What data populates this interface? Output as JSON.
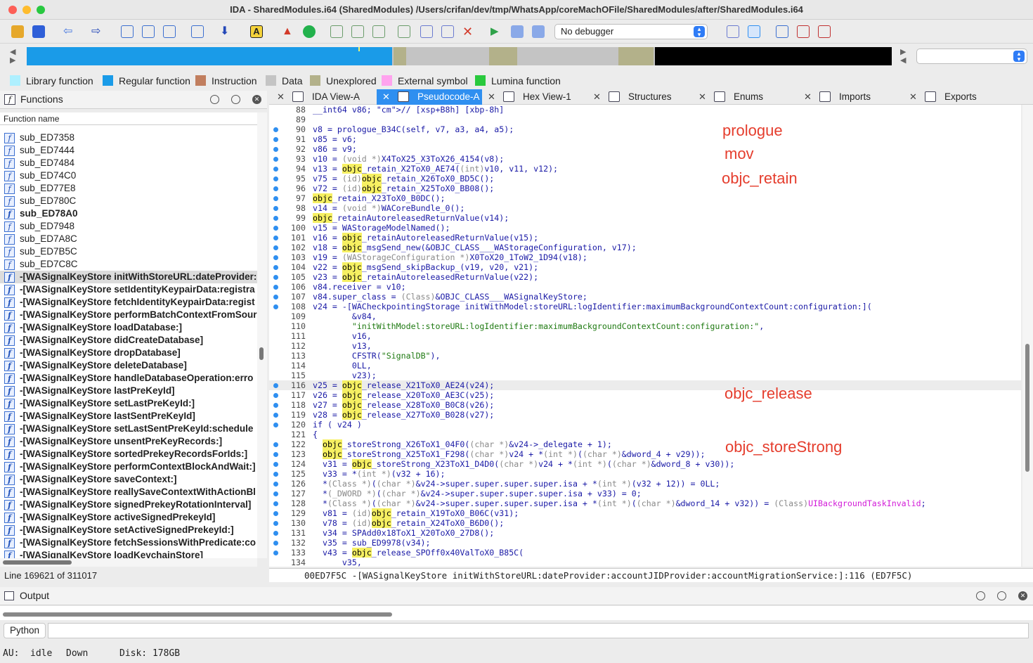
{
  "window": {
    "title": "IDA - SharedModules.i64 (SharedModules) /Users/crifan/dev/tmp/WhatsApp/coreMachOFile/SharedModules/after/SharedModules.i64"
  },
  "toolbar": {
    "debugger_select": "No debugger"
  },
  "legend": [
    {
      "label": "Library function",
      "color": "#aef0ff"
    },
    {
      "label": "Regular function",
      "color": "#1a9be8"
    },
    {
      "label": "Instruction",
      "color": "#c17e5e"
    },
    {
      "label": "Data",
      "color": "#c4c4c4"
    },
    {
      "label": "Unexplored",
      "color": "#b3b18a"
    },
    {
      "label": "External symbol",
      "color": "#ffa3ee"
    },
    {
      "label": "Lumina function",
      "color": "#29c93d"
    }
  ],
  "functions_panel": {
    "title": "Functions",
    "column_header": "Function name",
    "items": [
      {
        "name": "sub_ED7358",
        "bold": false
      },
      {
        "name": "sub_ED7444",
        "bold": false
      },
      {
        "name": "sub_ED7484",
        "bold": false
      },
      {
        "name": "sub_ED74C0",
        "bold": false
      },
      {
        "name": "sub_ED77E8",
        "bold": false
      },
      {
        "name": "sub_ED780C",
        "bold": false
      },
      {
        "name": "sub_ED78A0",
        "bold": true
      },
      {
        "name": "sub_ED7948",
        "bold": false
      },
      {
        "name": "sub_ED7A8C",
        "bold": false
      },
      {
        "name": "sub_ED7B5C",
        "bold": false
      },
      {
        "name": "sub_ED7C8C",
        "bold": false
      },
      {
        "name": "-[WASignalKeyStore initWithStoreURL:dateProvider:",
        "bold": true,
        "selected": true
      },
      {
        "name": "-[WASignalKeyStore setIdentityKeypairData:registra",
        "bold": true
      },
      {
        "name": "-[WASignalKeyStore fetchIdentityKeypairData:regist",
        "bold": true
      },
      {
        "name": "-[WASignalKeyStore performBatchContextFromSour",
        "bold": true
      },
      {
        "name": "-[WASignalKeyStore loadDatabase:]",
        "bold": true
      },
      {
        "name": "-[WASignalKeyStore didCreateDatabase]",
        "bold": true
      },
      {
        "name": "-[WASignalKeyStore dropDatabase]",
        "bold": true
      },
      {
        "name": "-[WASignalKeyStore deleteDatabase]",
        "bold": true
      },
      {
        "name": "-[WASignalKeyStore handleDatabaseOperation:erro",
        "bold": true
      },
      {
        "name": "-[WASignalKeyStore lastPreKeyId]",
        "bold": true
      },
      {
        "name": "-[WASignalKeyStore setLastPreKeyId:]",
        "bold": true
      },
      {
        "name": "-[WASignalKeyStore lastSentPreKeyId]",
        "bold": true
      },
      {
        "name": "-[WASignalKeyStore setLastSentPreKeyId:schedule",
        "bold": true
      },
      {
        "name": "-[WASignalKeyStore unsentPreKeyRecords:]",
        "bold": true
      },
      {
        "name": "-[WASignalKeyStore sortedPrekeyRecordsForIds:]",
        "bold": true
      },
      {
        "name": "-[WASignalKeyStore performContextBlockAndWait:]",
        "bold": true
      },
      {
        "name": "-[WASignalKeyStore saveContext:]",
        "bold": true
      },
      {
        "name": "-[WASignalKeyStore reallySaveContextWithActionBl",
        "bold": true
      },
      {
        "name": "-[WASignalKeyStore signedPrekeyRotationInterval]",
        "bold": true
      },
      {
        "name": "-[WASignalKeyStore activeSignedPrekeyId]",
        "bold": true
      },
      {
        "name": "-[WASignalKeyStore setActiveSignedPrekeyId:]",
        "bold": true
      },
      {
        "name": "-[WASignalKeyStore fetchSessionsWithPredicate:co",
        "bold": true
      },
      {
        "name": "-[WASignalKeyStore loadKeychainStore]",
        "bold": true
      }
    ],
    "status": "Line 169621 of 311017"
  },
  "tabs": [
    {
      "label": "IDA View-A",
      "active": false
    },
    {
      "label": "Pseudocode-A",
      "active": true
    },
    {
      "label": "Hex View-1",
      "active": false
    },
    {
      "label": "Structures",
      "active": false
    },
    {
      "label": "Enums",
      "active": false
    },
    {
      "label": "Imports",
      "active": false
    },
    {
      "label": "Exports",
      "active": false
    }
  ],
  "code_lines": [
    {
      "n": "88",
      "dot": false,
      "t": "__int64 v86; // [xsp+B8h] [xbp-8h]"
    },
    {
      "n": "89",
      "dot": false,
      "t": ""
    },
    {
      "n": "90",
      "dot": true,
      "t": "v8 = prologue_B34C(self, v7, a3, a4, a5);"
    },
    {
      "n": "91",
      "dot": true,
      "t": "v85 = v6;"
    },
    {
      "n": "92",
      "dot": true,
      "t": "v86 = v9;"
    },
    {
      "n": "93",
      "dot": true,
      "t": "v10 = (void *)X4ToX25_X3ToX26_4154(v8);"
    },
    {
      "n": "94",
      "dot": true,
      "t": "v13 = objc_retain_X2ToX0_AE74((int)v10, v11, v12);"
    },
    {
      "n": "95",
      "dot": true,
      "t": "v75 = (id)objc_retain_X26ToX0_BD5C();"
    },
    {
      "n": "96",
      "dot": true,
      "t": "v72 = (id)objc_retain_X25ToX0_BB08();"
    },
    {
      "n": "97",
      "dot": true,
      "t": "objc_retain_X23ToX0_B0DC();"
    },
    {
      "n": "98",
      "dot": true,
      "t": "v14 = (void *)WACoreBundle_0();"
    },
    {
      "n": "99",
      "dot": true,
      "t": "objc_retainAutoreleasedReturnValue(v14);"
    },
    {
      "n": "100",
      "dot": true,
      "t": "v15 = WAStorageModelNamed();"
    },
    {
      "n": "101",
      "dot": true,
      "t": "v16 = objc_retainAutoreleasedReturnValue(v15);"
    },
    {
      "n": "102",
      "dot": true,
      "t": "v18 = objc_msgSend_new(&OBJC_CLASS___WAStorageConfiguration, v17);"
    },
    {
      "n": "103",
      "dot": true,
      "t": "v19 = (WAStorageConfiguration *)X0ToX20_1ToW2_1D94(v18);"
    },
    {
      "n": "104",
      "dot": true,
      "t": "v22 = objc_msgSend_skipBackup_(v19, v20, v21);"
    },
    {
      "n": "105",
      "dot": true,
      "t": "v23 = objc_retainAutoreleasedReturnValue(v22);"
    },
    {
      "n": "106",
      "dot": true,
      "t": "v84.receiver = v10;"
    },
    {
      "n": "107",
      "dot": true,
      "t": "v84.super_class = (Class)&OBJC_CLASS___WASignalKeyStore;"
    },
    {
      "n": "108",
      "dot": true,
      "t": "v24 = -[WACheckpointingStorage initWithModel:storeURL:logIdentifier:maximumBackgroundContextCount:configuration:]("
    },
    {
      "n": "109",
      "dot": false,
      "t": "        &v84,"
    },
    {
      "n": "110",
      "dot": false,
      "t": "        \"initWithModel:storeURL:logIdentifier:maximumBackgroundContextCount:configuration:\","
    },
    {
      "n": "111",
      "dot": false,
      "t": "        v16,"
    },
    {
      "n": "112",
      "dot": false,
      "t": "        v13,"
    },
    {
      "n": "113",
      "dot": false,
      "t": "        CFSTR(\"SignalDB\"),"
    },
    {
      "n": "114",
      "dot": false,
      "t": "        0LL,"
    },
    {
      "n": "115",
      "dot": false,
      "t": "        v23);"
    },
    {
      "n": "116",
      "dot": true,
      "t": "v25 = objc_release_X21ToX0_AE24(v24);",
      "current": true
    },
    {
      "n": "117",
      "dot": true,
      "t": "v26 = objc_release_X20ToX0_AE3C(v25);"
    },
    {
      "n": "118",
      "dot": true,
      "t": "v27 = objc_release_X28ToX0_B0C8(v26);"
    },
    {
      "n": "119",
      "dot": true,
      "t": "v28 = objc_release_X27ToX0_B028(v27);"
    },
    {
      "n": "120",
      "dot": true,
      "t": "if ( v24 )"
    },
    {
      "n": "121",
      "dot": false,
      "t": "{"
    },
    {
      "n": "122",
      "dot": true,
      "t": "  objc_storeStrong_X26ToX1_04F0((char *)&v24->_delegate + 1);"
    },
    {
      "n": "123",
      "dot": true,
      "t": "  objc_storeStrong_X25ToX1_F298((char *)v24 + *(int *)((char *)&dword_4 + v29));"
    },
    {
      "n": "124",
      "dot": true,
      "t": "  v31 = objc_storeStrong_X23ToX1_D4D0((char *)v24 + *(int *)((char *)&dword_8 + v30));"
    },
    {
      "n": "125",
      "dot": true,
      "t": "  v33 = *(int *)(v32 + 16);"
    },
    {
      "n": "126",
      "dot": true,
      "t": "  *(Class *)((char *)&v24->super.super.super.super.isa + *(int *)(v32 + 12)) = 0LL;"
    },
    {
      "n": "127",
      "dot": true,
      "t": "  *(_DWORD *)((char *)&v24->super.super.super.super.isa + v33) = 0;"
    },
    {
      "n": "128",
      "dot": true,
      "t": "  *(Class *)((char *)&v24->super.super.super.super.isa + *(int *)((char *)&dword_14 + v32)) = (Class)UIBackgroundTaskInvalid;"
    },
    {
      "n": "129",
      "dot": true,
      "t": "  v81 = (id)objc_retain_X19ToX0_B06C(v31);"
    },
    {
      "n": "130",
      "dot": true,
      "t": "  v78 = (id)objc_retain_X24ToX0_B6D0();"
    },
    {
      "n": "131",
      "dot": true,
      "t": "  v34 = SPAdd0x18ToX1_X20ToX0_27D8();"
    },
    {
      "n": "132",
      "dot": true,
      "t": "  v35 = sub_ED9978(v34);"
    },
    {
      "n": "133",
      "dot": true,
      "t": "  v43 = objc_release_SPOff0x40ValToX0_B85C("
    },
    {
      "n": "134",
      "dot": false,
      "t": "      v35,"
    }
  ],
  "annotations": [
    {
      "text": "prologue"
    },
    {
      "text": "mov"
    },
    {
      "text": "objc_retain"
    },
    {
      "text": "objc_release"
    },
    {
      "text": "objc_storeStrong"
    }
  ],
  "code_status": "00ED7F5C -[WASignalKeyStore initWithStoreURL:dateProvider:accountJIDProvider:accountMigrationService:]:116 (ED7F5C)",
  "output_panel": {
    "title": "Output",
    "python_button": "Python"
  },
  "status_bar": {
    "au": "AU:",
    "state": "idle",
    "direction": "Down",
    "disk": "Disk: 178GB"
  }
}
